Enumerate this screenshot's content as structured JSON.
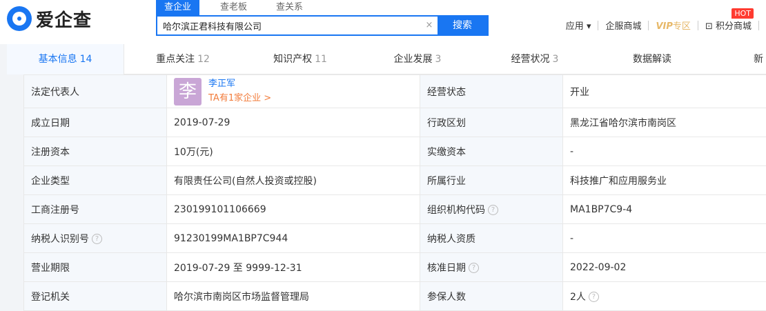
{
  "logo": {
    "text": "爱企查"
  },
  "search": {
    "tabs": [
      "查企业",
      "查老板",
      "查关系"
    ],
    "value": "哈尔滨正君科技有限公司",
    "button": "搜索"
  },
  "topnav": {
    "apps": "应用",
    "mall": "企服商城",
    "vip": "VIP",
    "vip_zone": "专区",
    "points": "积分商城",
    "hot": "HOT"
  },
  "tabs": [
    {
      "label": "基本信息",
      "count": "14"
    },
    {
      "label": "重点关注",
      "count": "12"
    },
    {
      "label": "知识产权",
      "count": "11"
    },
    {
      "label": "企业发展",
      "count": "3"
    },
    {
      "label": "经营状况",
      "count": "3"
    },
    {
      "label": "数据解读",
      "count": ""
    },
    {
      "label": "新",
      "count": ""
    }
  ],
  "rep": {
    "label": "法定代表人",
    "avatar": "李",
    "name": "李正军",
    "link": "TA有1家企业 >"
  },
  "rows": [
    {
      "l1": "成立日期",
      "v1": "2019-07-29",
      "l2": "行政区划",
      "v2": "黑龙江省哈尔滨市南岗区"
    },
    {
      "l1": "注册资本",
      "v1": "10万(元)",
      "l2": "实缴资本",
      "v2": "-"
    },
    {
      "l1": "企业类型",
      "v1": "有限责任公司(自然人投资或控股)",
      "l2": "所属行业",
      "v2": "科技推广和应用服务业"
    },
    {
      "l1": "工商注册号",
      "v1": "230199101106669",
      "l2": "组织机构代码",
      "v2": "MA1BP7C9-4"
    },
    {
      "l1": "纳税人识别号",
      "v1": "91230199MA1BP7C944",
      "l2": "纳税人资质",
      "v2": "-"
    },
    {
      "l1": "营业期限",
      "v1": "2019-07-29 至 9999-12-31",
      "l2": "核准日期",
      "v2": "2022-09-02"
    },
    {
      "l1": "登记机关",
      "v1": "哈尔滨市南岗区市场监督管理局",
      "l2": "参保人数",
      "v2": "2人"
    }
  ],
  "status": {
    "label": "经营状态",
    "value": "开业"
  }
}
